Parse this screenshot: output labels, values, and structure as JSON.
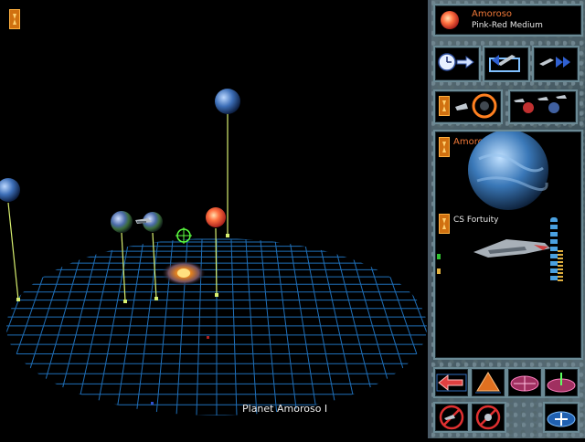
{
  "viewport": {
    "target_label": "Planet Amoroso I"
  },
  "star_info": {
    "name": "Amoroso",
    "type": "Pink-Red Medium"
  },
  "selected_planet": {
    "name": "Amoroso II"
  },
  "selected_ship": {
    "name": "CS Fortuity"
  },
  "colors": {
    "grid": "#1f6fb8",
    "stalk": "#d8f070",
    "name_accent": "#f07838",
    "panel_slot_border": "#6b8a95"
  },
  "icons": {
    "time_advance": "clock-arrow-icon",
    "launch_ship": "ship-launch-icon",
    "fast_forward_fleet": "fleet-fast-forward-icon",
    "hourglass": "hourglass-icon",
    "system_view": "system-map-icon",
    "fleet_view": "fleet-view-icon",
    "exit_left": "exit-arrow-icon",
    "tilt_up": "tilt-grid-icon",
    "grid_plane": "grid-plane-icon",
    "grid_axis": "grid-axis-icon",
    "no_move": "no-move-icon",
    "no_target": "no-target-icon",
    "zoom_in": "zoom-grid-icon"
  }
}
